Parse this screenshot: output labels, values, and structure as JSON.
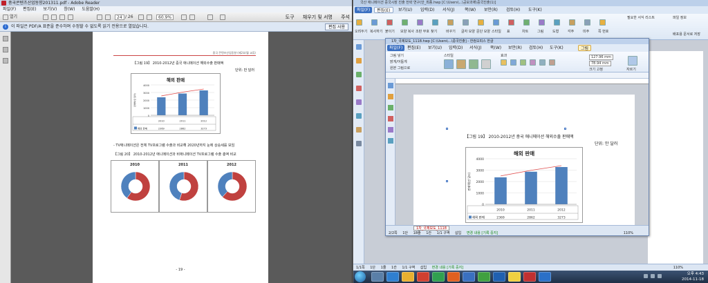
{
  "reader": {
    "title": "중국콘텐츠산업동향201311.pdf - Adobe Reader",
    "menu": [
      "파일(F)",
      "편집(E)",
      "보기(V)",
      "창(W)",
      "도움말(H)"
    ],
    "toolbar": {
      "open_label": "열기",
      "page_current": "24",
      "page_total": "/ 26",
      "zoom": "60.9%",
      "tools_label": "도구",
      "sign_label": "채우기 및 서명",
      "comment_label": "주석"
    },
    "info_bar": {
      "message": "이 파일은 PDF/A 표준을 준수하며 수정할 수 없도록 읽기 전용으로 열었습니다.",
      "edit_button": "편집 사용"
    },
    "page": {
      "header": "중국 콘텐츠산업동향 (제2호/월 교류)",
      "fig19_caption": "【그림 19】 2010-2012년 중국 애니메이션 해외수출 판매액",
      "unit": "단위: 만 달러",
      "body_text": "- TV애니메이션은 전체 TV프로그램 수출과 비교해 2020년까지 눈에 상승세를 보임",
      "fig20_caption": "【그림 20】 2010-2012년 애니메이션과 비애니메이션 TV프로그램 수출 총액 비교",
      "pie_years": [
        "2010",
        "2011",
        "2012"
      ],
      "page_number": "- 19 -"
    }
  },
  "hwp": {
    "back_title": "국산 애니메이션 중국시장 진출 전략 연구(안_최종.hwp [C:\\Users\\...\\공모과제\\중국진출(1)]",
    "tabs": [
      "파일(F)",
      "편집(E)",
      "보기(U)",
      "입력(D)",
      "서식(J)",
      "쪽(W)",
      "보안(R)",
      "검토(H)",
      "도구(K)"
    ],
    "ribbon_groups": [
      "오려두기",
      "복사하기",
      "붙이기",
      "모양 복사",
      "조판 부호",
      "찾기",
      "바꾸기",
      "글자 모양",
      "문단 모양",
      "스타일",
      "표",
      "차트",
      "그림",
      "도형",
      "각주",
      "미주",
      "쪽 번호"
    ],
    "right_groups": [
      "필요한 서식 리스트",
      "파일 정보",
      "배포용 문서로 저장"
    ],
    "left_panel_label": "쪽",
    "status": {
      "page": "1/1쪽",
      "section": "1단",
      "line": "1줄",
      "col": "1칸",
      "section_label": "1/1 구역",
      "insert": "삽입",
      "change_log": "변경 내용 [기록 중지]",
      "zoom": "110%"
    }
  },
  "front": {
    "title": "1차_국제보도_1118.hwp [C:\\Users\\...\\중국진출] - 한컴오피스 한글",
    "tabs": [
      "파일(F)",
      "편집(E)",
      "보기(U)",
      "입력(D)",
      "서식(J)",
      "쪽(W)",
      "보안(R)",
      "검토(H)",
      "도구(K)",
      "그림"
    ],
    "ribbon": {
      "picture_in": "그림 넣기",
      "bright": "밝게/어둡게",
      "contrast": "원본 그림으로",
      "style_label": "스타일",
      "effect_label": "효과",
      "width": "127.96 mm",
      "height": "78.94 mm",
      "size_label": "크기 고정",
      "wrap_label": "자르기"
    },
    "page": {
      "caption": "【그림 19】 2010-2012년 중국 애니메이션 해외수출 판매액",
      "unit": "단위: 만 달러"
    },
    "status": {
      "tab_name": "1차_국제보도_1118",
      "page": "2/2쪽",
      "col": "1단",
      "line": "18줄",
      "pos": "1칸",
      "row": "1/1 구역",
      "insert": "삽입",
      "change_log": "변경 내용 [기록 중지]",
      "zoom": "110%"
    }
  },
  "taskbar": {
    "time": "오후 4:43",
    "date": "2014-11-18"
  },
  "chart_data": [
    {
      "type": "bar",
      "title": "해외 판매",
      "categories": [
        "2010",
        "2011",
        "2012"
      ],
      "series": [
        {
          "name": "해외 판매",
          "values": [
            2369,
            2862,
            3273
          ]
        }
      ],
      "ylabel": "판매액(만 달러)",
      "ylim": [
        0,
        4000
      ],
      "yticks": [
        "0",
        "1000",
        "2000",
        "3000",
        "4000"
      ],
      "has_trendline": true,
      "table": true
    },
    {
      "type": "pie",
      "title": "2010",
      "values": [
        0.6,
        0.4
      ],
      "colors": [
        "#c0413f",
        "#4f81bd"
      ]
    },
    {
      "type": "pie",
      "title": "2011",
      "values": [
        0.55,
        0.45
      ],
      "colors": [
        "#c0413f",
        "#4f81bd"
      ]
    },
    {
      "type": "pie",
      "title": "2012",
      "values": [
        0.62,
        0.38
      ],
      "colors": [
        "#c0413f",
        "#4f81bd"
      ]
    }
  ]
}
